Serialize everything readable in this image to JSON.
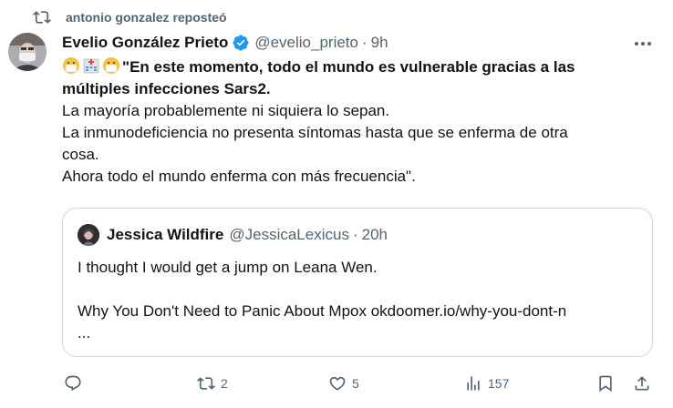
{
  "repost": {
    "icon": "repost-icon",
    "text": "antonio gonzalez reposteó"
  },
  "tweet": {
    "author_name": "Evelio González Prieto",
    "verified": true,
    "handle": "@evelio_prieto",
    "separator": "·",
    "time": "9h",
    "emoji_prefix": [
      "face-with-medical-mask",
      "hospital",
      "face-with-medical-mask"
    ],
    "quote_open": "\"",
    "bold_line1": "En este momento, todo el mundo es vulnerable gracias a las",
    "bold_line2": "múltiples infecciones Sars2.",
    "line3": "La mayoría probablemente ni siquiera lo sepan.",
    "line4": "La inmunodeficiencia no presenta síntomas hasta que se enferma de otra",
    "line5": "cosa.",
    "line6": "Ahora todo el mundo enferma con más frecuencia\"."
  },
  "quoted": {
    "author_name": "Jessica Wildfire",
    "handle": "@JessicaLexicus",
    "separator": "·",
    "time": "20h",
    "line1": "I thought I would get a jump on Leana Wen.",
    "line2": "Why You Don't Need to Panic About Mpox okdoomer.io/why-you-dont-n",
    "line3": "..."
  },
  "actions": {
    "reply": {
      "icon": "reply-icon",
      "count": ""
    },
    "repost": {
      "icon": "repost-icon",
      "count": "2"
    },
    "like": {
      "icon": "heart-icon",
      "count": "5"
    },
    "views": {
      "icon": "views-icon",
      "count": "157"
    },
    "bookmark": {
      "icon": "bookmark-icon"
    },
    "share": {
      "icon": "share-icon"
    }
  },
  "colors": {
    "text": "#0f1419",
    "secondary": "#536471",
    "verified": "#1d9bf0",
    "border": "#cfd9de"
  }
}
